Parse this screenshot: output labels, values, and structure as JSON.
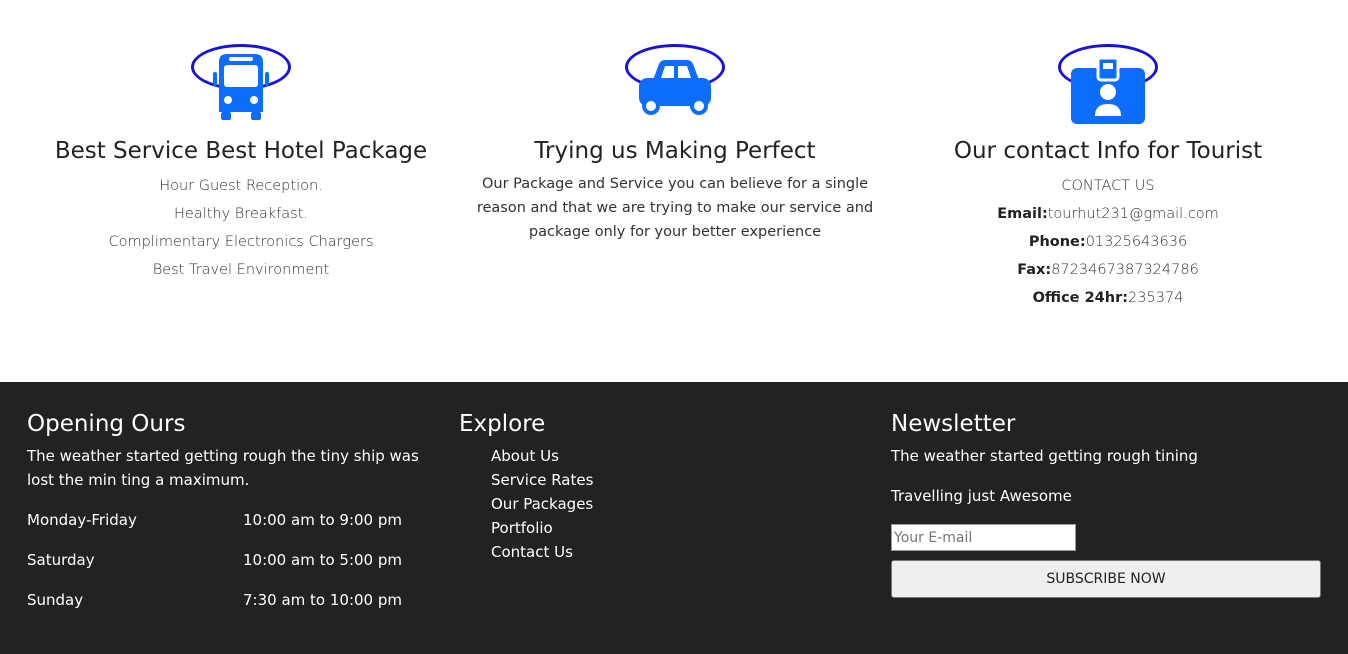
{
  "features": [
    {
      "icon": "bus-icon",
      "title": "Best Service Best Hotel Package",
      "lines": [
        "Hour Guest Reception.",
        "Healthy Breakfast.",
        "Complimentary Electronics Chargers",
        "Best Travel Environment"
      ]
    },
    {
      "icon": "car-icon",
      "title": "Trying us Making Perfect",
      "paragraph": "Our Package and Service you can believe for a single reason and that we are trying to make our service and package only for your better experience"
    },
    {
      "icon": "id-badge-icon",
      "title": "Our contact Info for Tourist",
      "heading": "CONTACT US",
      "contacts": [
        {
          "label": "Email:",
          "value": "tourhut231@gmail.com"
        },
        {
          "label": "Phone:",
          "value": "01325643636"
        },
        {
          "label": "Fax:",
          "value": "8723467387324786"
        },
        {
          "label": "Office 24hr:",
          "value": "235374"
        }
      ]
    }
  ],
  "footer": {
    "opening": {
      "title": "Opening Ours",
      "text": "The weather started getting rough the tiny ship was lost the min ting a maximum.",
      "hours": [
        {
          "day": "Monday-Friday",
          "time": "10:00 am to 9:00 pm"
        },
        {
          "day": "Saturday",
          "time": "10:00 am to 5:00 pm"
        },
        {
          "day": "Sunday",
          "time": "7:30 am to 10:00 pm"
        }
      ]
    },
    "explore": {
      "title": "Explore",
      "links": [
        "About Us",
        "Service Rates",
        "Our Packages",
        "Portfolio",
        "Contact Us"
      ]
    },
    "newsletter": {
      "title": "Newsletter",
      "text1": "The weather started getting rough tining",
      "text2": "Travelling just Awesome",
      "placeholder": "Your E-mail",
      "button": "SUBSCRIBE NOW"
    }
  },
  "colors": {
    "icon_blue": "#0d6efd",
    "ring": "#1a12d8",
    "footer_bg": "#222222"
  }
}
